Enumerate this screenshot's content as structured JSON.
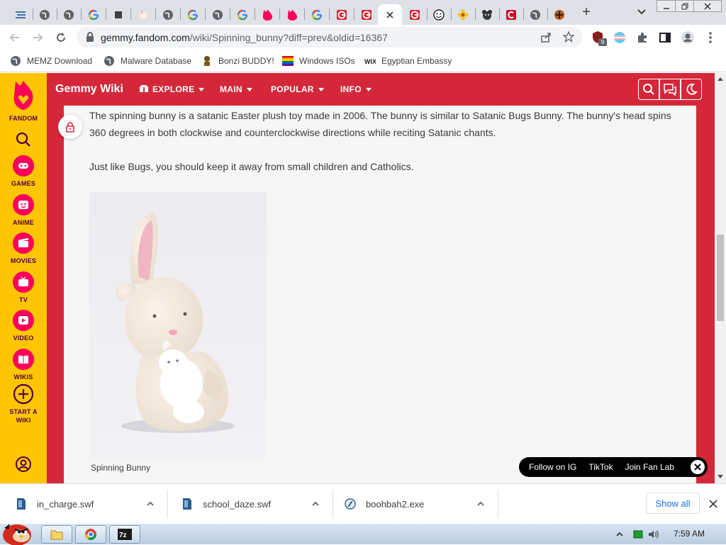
{
  "browser": {
    "tabs": [
      {
        "icon": "blue-bars-icon"
      },
      {
        "icon": "globe-icon"
      },
      {
        "icon": "globe-icon"
      },
      {
        "icon": "google-g-icon"
      },
      {
        "icon": "dark-square-icon"
      },
      {
        "icon": "bunny-thumb-icon"
      },
      {
        "icon": "globe-icon"
      },
      {
        "icon": "google-g-icon"
      },
      {
        "icon": "globe-icon"
      },
      {
        "icon": "google-g-icon"
      },
      {
        "icon": "fandom-flame-icon"
      },
      {
        "icon": "fandom-flame-icon"
      },
      {
        "icon": "google-g-icon"
      },
      {
        "icon": "red-g-icon"
      },
      {
        "icon": "red-g-icon"
      },
      {
        "icon": "close-icon",
        "active": true
      },
      {
        "icon": "red-g-icon"
      },
      {
        "icon": "smiley-icon"
      },
      {
        "icon": "flower-icon"
      },
      {
        "icon": "bear-icon"
      },
      {
        "icon": "red-c-icon"
      },
      {
        "icon": "globe-icon"
      },
      {
        "icon": "tf2-icon"
      }
    ],
    "new_tab_symbol": "+",
    "url_host": "gemmy.fandom.com",
    "url_path": "/wiki/Spinning_bunny?diff=prev&oldid=16367",
    "extension_badge": "9"
  },
  "bookmarks": [
    {
      "label": "MEMZ Download",
      "icon": "globe-icon"
    },
    {
      "label": "Malware Database",
      "icon": "globe-icon"
    },
    {
      "label": "Bonzi BUDDY!",
      "icon": "bonzi-icon"
    },
    {
      "label": "Windows ISOs",
      "icon": "windows-flag-icon"
    },
    {
      "label": "Egyptian Embassy",
      "icon": "wix-icon"
    }
  ],
  "rail": {
    "brand": "FANDOM",
    "items": [
      {
        "label": "GAMES",
        "icon": "gamepad-icon"
      },
      {
        "label": "ANIME",
        "icon": "anime-face-icon"
      },
      {
        "label": "MOVIES",
        "icon": "clapper-icon"
      },
      {
        "label": "TV",
        "icon": "tv-icon"
      },
      {
        "label": "VIDEO",
        "icon": "play-icon"
      },
      {
        "label": "WIKIS",
        "icon": "book-icon"
      },
      {
        "label": "START A WIKI",
        "icon": "plus-circle-icon"
      }
    ]
  },
  "wiki": {
    "title": "Gemmy Wiki",
    "nav": [
      {
        "label": "EXPLORE"
      },
      {
        "label": "MAIN"
      },
      {
        "label": "POPULAR"
      },
      {
        "label": "INFO"
      }
    ]
  },
  "article": {
    "paragraph1": "The spinning bunny is a satanic Easter plush toy made in 2006. The bunny is similar to Satanic Bugs Bunny. The bunny's head spins 360 degrees in both clockwise and counterclockwise directions while reciting Satanic chants.",
    "paragraph2": "Just like Bugs, you should keep it away from small children and Catholics.",
    "image_caption": "Spinning Bunny"
  },
  "cta": {
    "items": [
      "Follow on IG",
      "TikTok",
      "Join Fan Lab"
    ]
  },
  "downloads": {
    "items": [
      {
        "filename": "in_charge.swf",
        "icon": "swf-file-icon"
      },
      {
        "filename": "school_daze.swf",
        "icon": "swf-file-icon"
      },
      {
        "filename": "boohbah2.exe",
        "icon": "exe-file-icon"
      }
    ],
    "show_all": "Show all"
  },
  "taskbar": {
    "clock": "7:59 AM"
  },
  "colors": {
    "fandom_yellow": "#ffc500",
    "wiki_red": "#d4283a",
    "rail_text": "#520044"
  }
}
